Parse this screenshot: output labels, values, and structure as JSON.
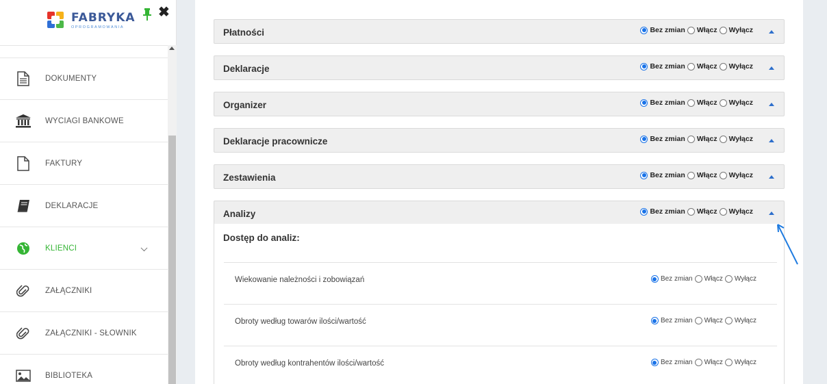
{
  "logo": {
    "title": "FABRYKA",
    "subtitle": "OPROGRAMOWANIA"
  },
  "sidebar": {
    "items": [
      {
        "label": "DOKUMENTY",
        "icon": "document-icon"
      },
      {
        "label": "WYCIAGI BANKOWE",
        "icon": "bank-icon"
      },
      {
        "label": "FAKTURY",
        "icon": "file-icon"
      },
      {
        "label": "DEKLARACJE",
        "icon": "book-icon"
      },
      {
        "label": "KLIENCI",
        "icon": "globe-icon",
        "active": true
      },
      {
        "label": "ZAŁĄCZNIKI",
        "icon": "paperclip-icon"
      },
      {
        "label": "ZAŁĄCZNIKI - SŁOWNIK",
        "icon": "paperclip-icon"
      },
      {
        "label": "BIBLIOTEKA",
        "icon": "image-icon"
      }
    ]
  },
  "options": {
    "unchanged": "Bez zmian",
    "enable": "Włącz",
    "disable": "Wyłącz"
  },
  "sections": [
    {
      "title": "Płatności"
    },
    {
      "title": "Deklaracje"
    },
    {
      "title": "Organizer"
    },
    {
      "title": "Deklaracje pracownicze"
    },
    {
      "title": "Zestawienia"
    },
    {
      "title": "Analizy"
    }
  ],
  "analizy": {
    "heading": "Dostęp do analiz:",
    "rows": [
      {
        "label": "Wiekowanie należności i zobowiązań"
      },
      {
        "label": "Obroty według towarów ilości/wartość"
      },
      {
        "label": "Obroty według kontrahentów ilości/wartość"
      }
    ]
  },
  "colors": {
    "accent": "#1a73e8",
    "active": "#35b535",
    "annotation": "#1e7be0"
  }
}
